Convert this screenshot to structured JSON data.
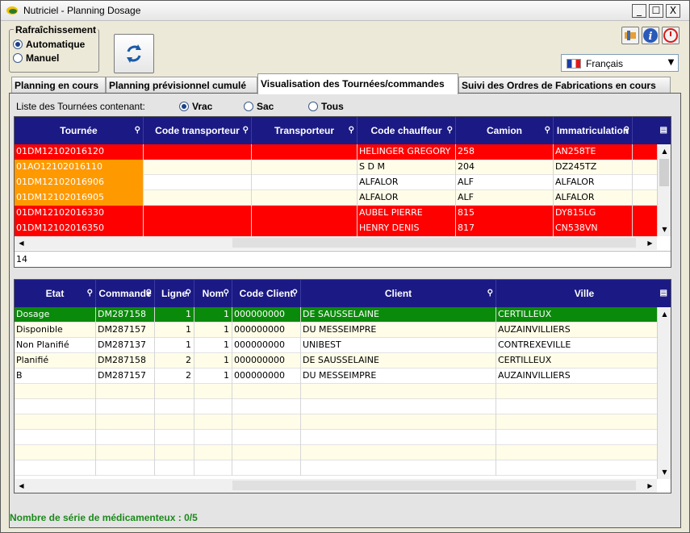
{
  "window": {
    "title": "Nutriciel - Planning Dosage",
    "controls": [
      "_",
      "☐",
      "X"
    ]
  },
  "refresh": {
    "legend": "Rafraîchissement",
    "options": [
      {
        "label": "Automatique",
        "selected": true
      },
      {
        "label": "Manuel",
        "selected": false
      }
    ]
  },
  "language": {
    "selected": "Français"
  },
  "tabs": [
    {
      "label": "Planning en cours",
      "active": false
    },
    {
      "label": "Planning prévisionnel cumulé",
      "active": false
    },
    {
      "label": "Visualisation des Tournées/commandes",
      "active": true
    },
    {
      "label": "Suivi des Ordres de Fabrications en cours",
      "active": false
    }
  ],
  "filter": {
    "label": "Liste des Tournées contenant:",
    "options": [
      {
        "label": "Vrac",
        "selected": true
      },
      {
        "label": "Sac",
        "selected": false
      },
      {
        "label": "Tous",
        "selected": false
      }
    ]
  },
  "tournees_grid": {
    "columns": [
      "Tournée",
      "Code transporteur",
      "Transporteur",
      "Code chauffeur",
      "Camion",
      "Immatriculation"
    ],
    "rows": [
      {
        "cells": [
          "01DM12102016120",
          "",
          "",
          "HELINGER GREGORY",
          "258",
          "AN258TE"
        ],
        "status": "red"
      },
      {
        "cells": [
          "01AO12102016110",
          "",
          "",
          "S D M",
          "204",
          "DZ245TZ"
        ],
        "status": "orange"
      },
      {
        "cells": [
          "01DM12102016906",
          "",
          "",
          "ALFALOR",
          "ALF",
          "ALFALOR"
        ],
        "status": "orange"
      },
      {
        "cells": [
          "01DM12102016905",
          "",
          "",
          "ALFALOR",
          "ALF",
          "ALFALOR"
        ],
        "status": "orange"
      },
      {
        "cells": [
          "01DM12102016330",
          "",
          "",
          "AUBEL PIERRE",
          "815",
          "DY815LG"
        ],
        "status": "red"
      },
      {
        "cells": [
          "01DM12102016350",
          "",
          "",
          "HENRY DENIS",
          "817",
          "CN538VN"
        ],
        "status": "red"
      }
    ],
    "count": "14"
  },
  "commandes_grid": {
    "columns": [
      "Etat",
      "Commande",
      "Ligne",
      "Nom",
      "Code Client",
      "Client",
      "Ville"
    ],
    "rows": [
      {
        "cells": [
          "Dosage",
          "DM287158",
          "1",
          "1",
          "000000000",
          "DE SAUSSELAINE",
          "CERTILLEUX"
        ],
        "status": "green"
      },
      {
        "cells": [
          "Disponible",
          "DM287157",
          "1",
          "1",
          "000000000",
          "DU MESSEIMPRE",
          "AUZAINVILLIERS"
        ],
        "status": "none"
      },
      {
        "cells": [
          "Non Planifié",
          "DM287137",
          "1",
          "1",
          "000000000",
          "UNIBEST",
          "CONTREXEVILLE"
        ],
        "status": "none"
      },
      {
        "cells": [
          "Planifié",
          "DM287158",
          "2",
          "1",
          "000000000",
          "DE SAUSSELAINE",
          "CERTILLEUX"
        ],
        "status": "none"
      },
      {
        "cells": [
          "B",
          "DM287157",
          "2",
          "1",
          "000000000",
          "DU MESSEIMPRE",
          "AUZAINVILLIERS"
        ],
        "status": "none"
      }
    ]
  },
  "footer": {
    "text": "Nombre de série de médicamenteux : 0/5"
  },
  "colors": {
    "header": "#1b1a84",
    "red": "#ff0000",
    "orange": "#ff9900",
    "green": "#0a8a0a",
    "row_alt": "#fffde8"
  },
  "icons": {
    "refresh": "refresh-icon",
    "tools": "tools-icon",
    "info": "info-icon",
    "power": "power-icon"
  }
}
